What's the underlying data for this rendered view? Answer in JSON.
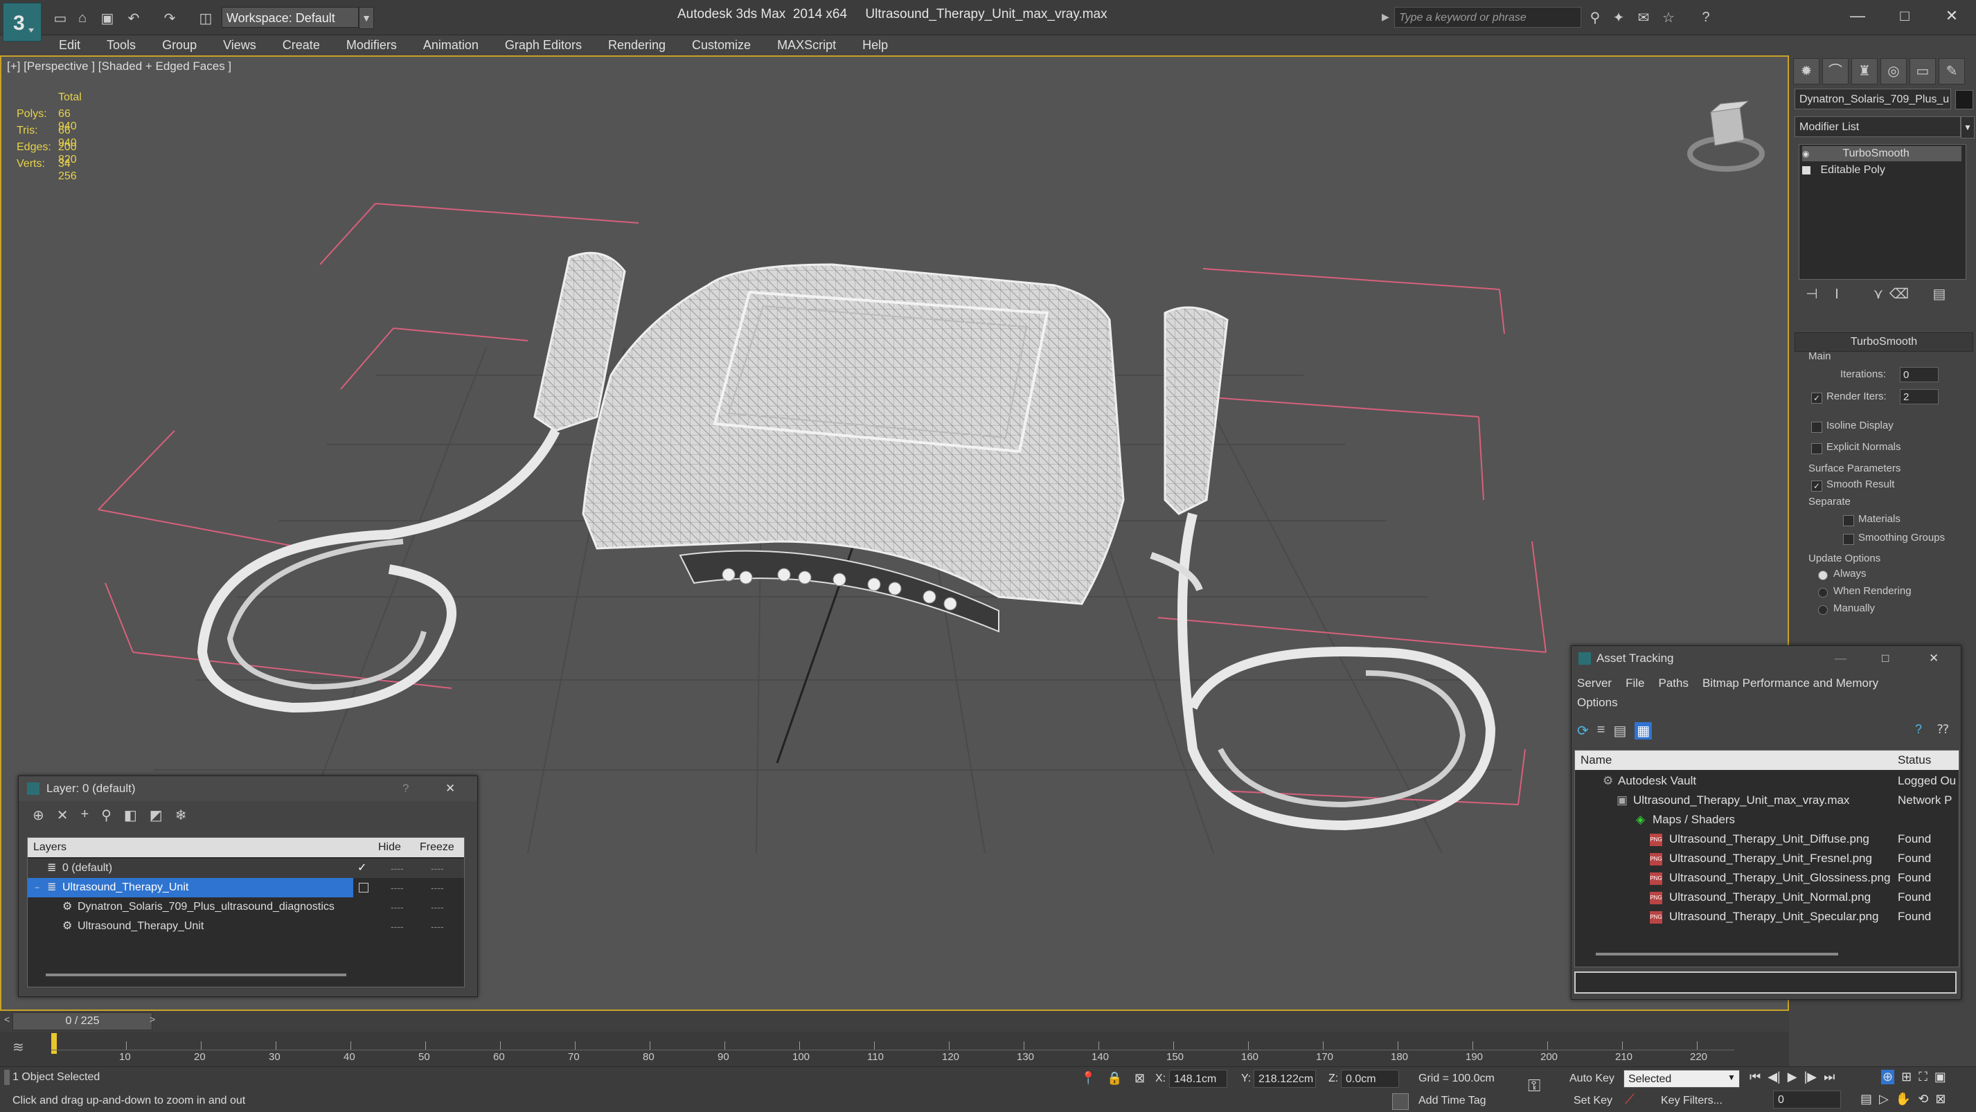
{
  "app": {
    "title": "Autodesk 3ds Max  2014 x64     Ultrasound_Therapy_Unit_max_vray.max",
    "workspace": "Workspace: Default",
    "search_placeholder": "Type a keyword or phrase"
  },
  "menu": [
    "Edit",
    "Tools",
    "Group",
    "Views",
    "Create",
    "Modifiers",
    "Animation",
    "Graph Editors",
    "Rendering",
    "Customize",
    "MAXScript",
    "Help"
  ],
  "viewport": {
    "label": "[+] [Perspective ] [Shaded + Edged Faces ]",
    "stats": {
      "header": "Total",
      "rows": [
        {
          "label": "Polys:",
          "value": "66 940"
        },
        {
          "label": "Tris:",
          "value": "66 940"
        },
        {
          "label": "Edges:",
          "value": "200 820"
        },
        {
          "label": "Verts:",
          "value": "34 256"
        }
      ]
    }
  },
  "command_panel": {
    "object_name": "Dynatron_Solaris_709_Plus_u",
    "modifier_list": "Modifier List",
    "stack": [
      "TurboSmooth",
      "Editable Poly"
    ],
    "rollout_title": "TurboSmooth",
    "main_label": "Main",
    "iterations_label": "Iterations:",
    "iterations_value": "0",
    "render_iters_label": "Render Iters:",
    "render_iters_value": "2",
    "isoline_label": "Isoline Display",
    "explicit_normals_label": "Explicit Normals",
    "surface_params_label": "Surface Parameters",
    "smooth_result_label": "Smooth Result",
    "separate_label": "Separate",
    "materials_label": "Materials",
    "smoothing_groups_label": "Smoothing Groups",
    "update_options_label": "Update Options",
    "always_label": "Always",
    "when_rendering_label": "When Rendering",
    "manually_label": "Manually"
  },
  "layer_manager": {
    "title": "Layer: 0 (default)",
    "help": "?",
    "columns": {
      "layers": "Layers",
      "hide": "Hide",
      "freeze": "Freeze"
    },
    "rows": [
      {
        "name": "0 (default)"
      },
      {
        "name": "Ultrasound_Therapy_Unit"
      },
      {
        "name": "Dynatron_Solaris_709_Plus_ultrasound_diagnostics"
      },
      {
        "name": "Ultrasound_Therapy_Unit"
      }
    ]
  },
  "asset_tracking": {
    "title": "Asset Tracking",
    "menu": [
      "Server",
      "File",
      "Paths",
      "Bitmap Performance and Memory"
    ],
    "options": "Options",
    "columns": {
      "name": "Name",
      "status": "Status"
    },
    "rows": [
      {
        "name": "Autodesk Vault",
        "status": "Logged Ou"
      },
      {
        "name": "Ultrasound_Therapy_Unit_max_vray.max",
        "status": "Network P"
      },
      {
        "name": "Maps / Shaders",
        "status": ""
      },
      {
        "name": "Ultrasound_Therapy_Unit_Diffuse.png",
        "status": "Found"
      },
      {
        "name": "Ultrasound_Therapy_Unit_Fresnel.png",
        "status": "Found"
      },
      {
        "name": "Ultrasound_Therapy_Unit_Glossiness.png",
        "status": "Found"
      },
      {
        "name": "Ultrasound_Therapy_Unit_Normal.png",
        "status": "Found"
      },
      {
        "name": "Ultrasound_Therapy_Unit_Specular.png",
        "status": "Found"
      }
    ]
  },
  "timeline": {
    "frame": "0 / 225",
    "ticks": [
      "10",
      "20",
      "30",
      "40",
      "50",
      "60",
      "70",
      "80",
      "90",
      "100",
      "110",
      "120",
      "130",
      "140",
      "150",
      "160",
      "170",
      "180",
      "190",
      "200",
      "210",
      "220"
    ]
  },
  "status": {
    "selected": "1 Object Selected",
    "prompt": "Click and drag up-and-down to zoom in and out",
    "x_label": "X:",
    "x_value": "148.1cm",
    "y_label": "Y:",
    "y_value": "218.122cm",
    "z_label": "Z:",
    "z_value": "0.0cm",
    "grid": "Grid = 100.0cm",
    "add_time_tag": "Add Time Tag",
    "auto_key": "Auto Key",
    "set_key": "Set Key",
    "key_mode": "Selected",
    "key_filters": "Key Filters...",
    "current_frame": "0"
  }
}
